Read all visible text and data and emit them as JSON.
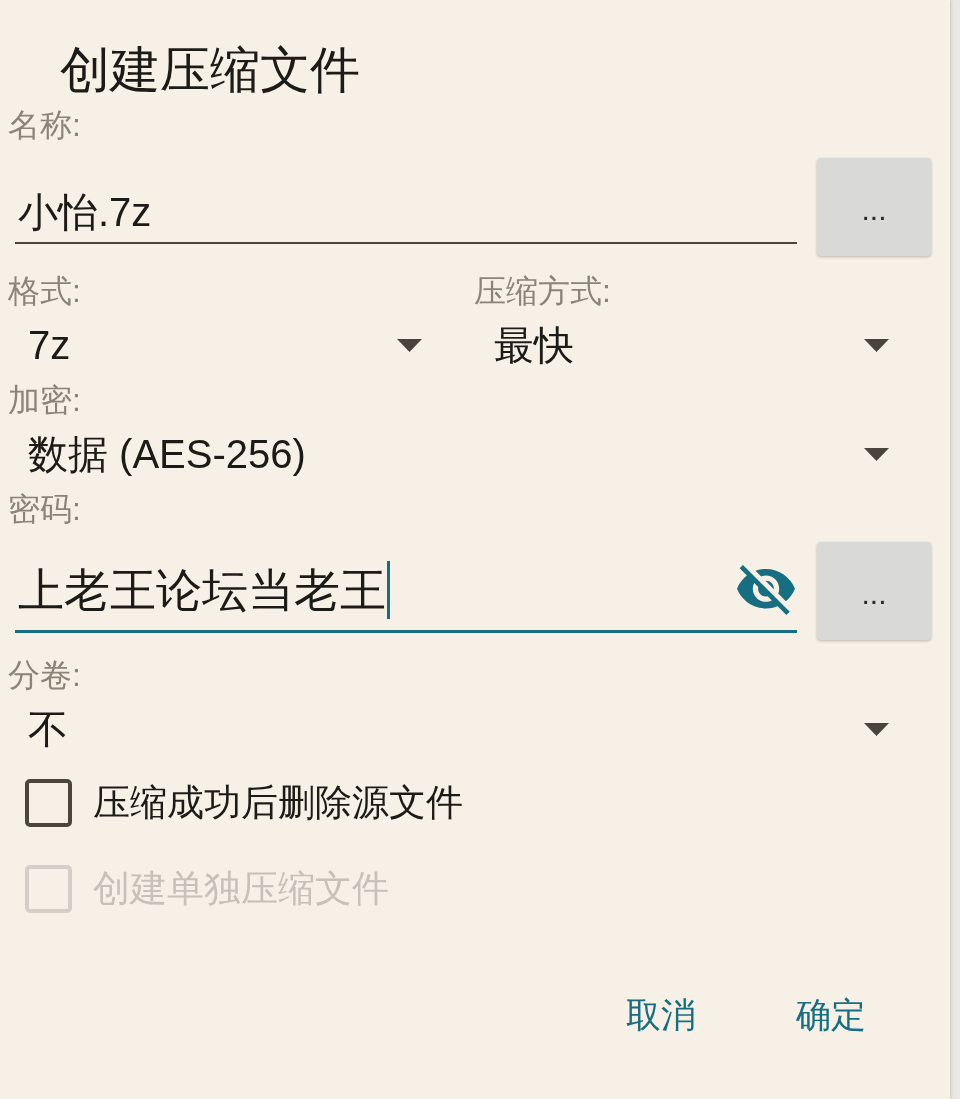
{
  "title": "创建压缩文件",
  "rows": [
    {
      "fields": [
        {
          "kind": "text",
          "label": "名称:",
          "value": "小怡.7z",
          "focused": false,
          "button": "..."
        }
      ]
    },
    {
      "fields": [
        {
          "kind": "dropdown",
          "label": "格式:",
          "value": "7z"
        },
        {
          "kind": "dropdown",
          "label": "压缩方式:",
          "value": "最快"
        }
      ]
    },
    {
      "fields": [
        {
          "kind": "dropdown",
          "label": "加密:",
          "value": "数据 (AES-256)"
        }
      ]
    },
    {
      "fields": [
        {
          "kind": "password",
          "label": "密码:",
          "value": "上老王论坛当老王",
          "focused": true,
          "password_visible": true,
          "button": "..."
        }
      ]
    },
    {
      "fields": [
        {
          "kind": "dropdown",
          "label": "分卷:",
          "value": "不"
        }
      ]
    }
  ],
  "checkboxes": [
    {
      "label": "压缩成功后删除源文件",
      "checked": false,
      "disabled": false
    },
    {
      "label": "创建单独压缩文件",
      "checked": false,
      "disabled": true
    }
  ],
  "buttons": [
    "取消",
    "确定"
  ]
}
